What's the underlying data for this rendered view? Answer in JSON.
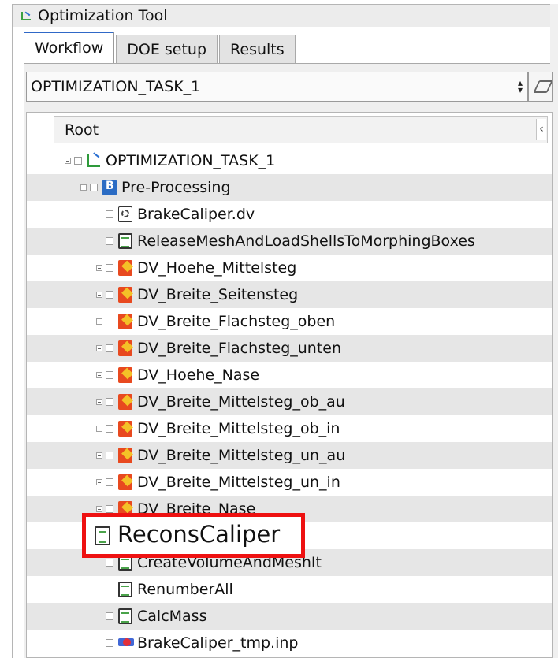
{
  "window": {
    "title": "Optimization Tool"
  },
  "tabs": [
    {
      "label": "Workflow",
      "active": true
    },
    {
      "label": "DOE setup",
      "active": false
    },
    {
      "label": "Results",
      "active": false
    }
  ],
  "task_combo": {
    "value": "OPTIMIZATION_TASK_1"
  },
  "tree": {
    "header": "Root",
    "rows": [
      {
        "label": "OPTIMIZATION_TASK_1",
        "icon": "task-icon"
      },
      {
        "label": "Pre-Processing",
        "icon": "preprocessing-icon"
      },
      {
        "label": "BrakeCaliper.dv",
        "icon": "dv-file-icon"
      },
      {
        "label": "ReleaseMeshAndLoadShellsToMorphingBoxes",
        "icon": "script-icon"
      },
      {
        "label": "DV_Hoehe_Mittelsteg",
        "icon": "design-variable-icon"
      },
      {
        "label": "DV_Breite_Seitensteg",
        "icon": "design-variable-icon"
      },
      {
        "label": "DV_Breite_Flachsteg_oben",
        "icon": "design-variable-icon"
      },
      {
        "label": "DV_Breite_Flachsteg_unten",
        "icon": "design-variable-icon"
      },
      {
        "label": "DV_Hoehe_Nase",
        "icon": "design-variable-icon"
      },
      {
        "label": "DV_Breite_Mittelsteg_ob_au",
        "icon": "design-variable-icon"
      },
      {
        "label": "DV_Breite_Mittelsteg_ob_in",
        "icon": "design-variable-icon"
      },
      {
        "label": "DV_Breite_Mittelsteg_un_au",
        "icon": "design-variable-icon"
      },
      {
        "label": "DV_Breite_Mittelsteg_un_in",
        "icon": "design-variable-icon"
      },
      {
        "label": "DV_Breite_Nase",
        "icon": "design-variable-icon"
      },
      {
        "label": "ReconsCaliper",
        "icon": "script-icon"
      },
      {
        "label": "CreateVolumeAndMeshIt",
        "icon": "script-icon"
      },
      {
        "label": "RenumberAll",
        "icon": "script-icon"
      },
      {
        "label": "CalcMass",
        "icon": "script-icon"
      },
      {
        "label": "BrakeCaliper_tmp.inp",
        "icon": "input-file-icon"
      }
    ]
  },
  "highlight": {
    "label": "ReconsCaliper",
    "color": "#ee1111"
  }
}
